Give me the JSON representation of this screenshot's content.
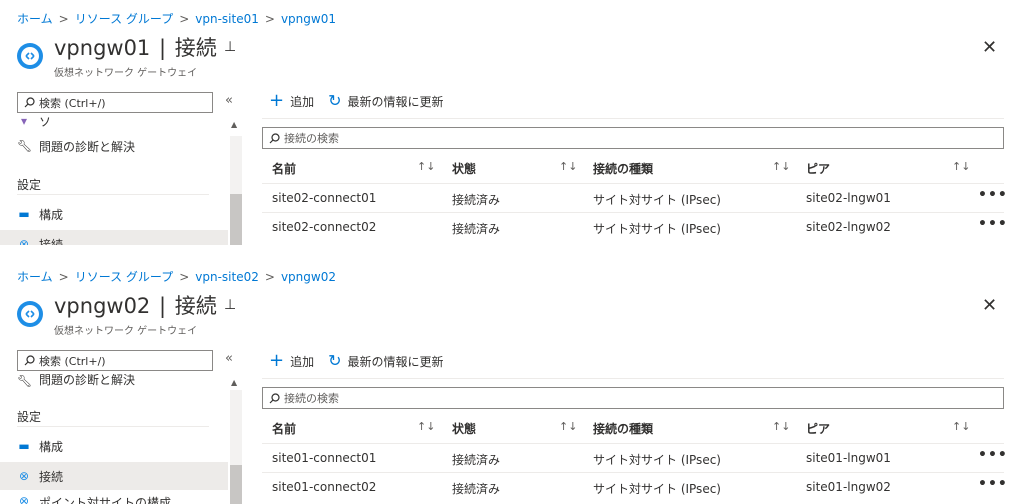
{
  "panels": [
    {
      "breadcrumb": [
        "ホーム",
        "リソース グループ",
        "vpn-site01",
        "vpngw01"
      ],
      "title_name": "vpngw01",
      "title_section": "接続",
      "subtitle": "仮想ネットワーク ゲートウェイ",
      "search_placeholder": "検索 (Ctrl+/)",
      "nav_top_item": "ソ",
      "nav_diag": "問題の診断と解決",
      "section_label": "設定",
      "nav_config": "構成",
      "nav_connections": "接続",
      "toolbar": {
        "add": "追加",
        "refresh": "最新の情報に更新"
      },
      "filter_placeholder": "接続の検索",
      "columns": [
        "名前",
        "状態",
        "接続の種類",
        "ピア"
      ],
      "rows": [
        {
          "name": "site02-connect01",
          "status": "接続済み",
          "type": "サイト対サイト (IPsec)",
          "peer": "site02-lngw01"
        },
        {
          "name": "site02-connect02",
          "status": "接続済み",
          "type": "サイト対サイト (IPsec)",
          "peer": "site02-lngw02"
        }
      ]
    },
    {
      "breadcrumb": [
        "ホーム",
        "リソース グループ",
        "vpn-site02",
        "vpngw02"
      ],
      "title_name": "vpngw02",
      "title_section": "接続",
      "subtitle": "仮想ネットワーク ゲートウェイ",
      "search_placeholder": "検索 (Ctrl+/)",
      "nav_diag": "問題の診断と解決",
      "section_label": "設定",
      "nav_config": "構成",
      "nav_connections": "接続",
      "nav_bottom_item": "ポイント対サイトの構成",
      "toolbar": {
        "add": "追加",
        "refresh": "最新の情報に更新"
      },
      "filter_placeholder": "接続の検索",
      "columns": [
        "名前",
        "状態",
        "接続の種類",
        "ピア"
      ],
      "rows": [
        {
          "name": "site01-connect01",
          "status": "接続済み",
          "type": "サイト対サイト (IPsec)",
          "peer": "site01-lngw01"
        },
        {
          "name": "site01-connect02",
          "status": "接続済み",
          "type": "サイト対サイト (IPsec)",
          "peer": "site01-lngw02"
        }
      ]
    }
  ],
  "icons": {
    "pin": "pin-icon",
    "close": "close-icon",
    "search": "search-icon",
    "add": "plus-icon",
    "refresh": "refresh-icon",
    "sort": "sort-icon",
    "more": "more-icon"
  },
  "glyphs": {
    "sep": ">",
    "close": "✕",
    "pin": "⊥",
    "collapse": "«",
    "sort": "↑↓",
    "more": "•••",
    "plus": "+",
    "refresh": "↻",
    "scroll_up": "▲"
  },
  "colors": {
    "accent": "#0078d4",
    "active_nav": "#edebe9",
    "border": "#8a8886"
  }
}
